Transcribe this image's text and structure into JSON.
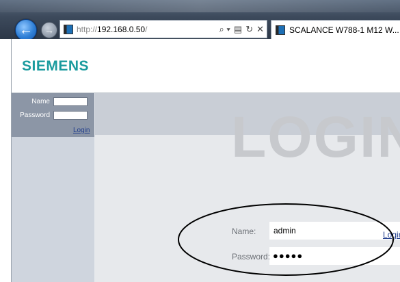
{
  "browser": {
    "url_prefix": "http://",
    "url_host": "192.168.0.50",
    "url_suffix": "/",
    "tab_title": "SCALANCE W788-1 M12 W...",
    "addr_tools": [
      "⌕ ▾",
      "▤",
      "↻",
      "✕"
    ]
  },
  "page": {
    "logo": "SIEMENS",
    "heading": "LOGIN",
    "sidebar": {
      "name_label": "Name",
      "password_label": "Password",
      "login_link": "Login"
    },
    "form": {
      "name_label": "Name:",
      "name_value": "admin",
      "password_label": "Password:",
      "password_value": "●●●●●",
      "login_link": "Login"
    }
  },
  "colors": {
    "brand": "#1a9b9e",
    "sidebar": "#8c96a6",
    "link": "#1e3c8c"
  }
}
